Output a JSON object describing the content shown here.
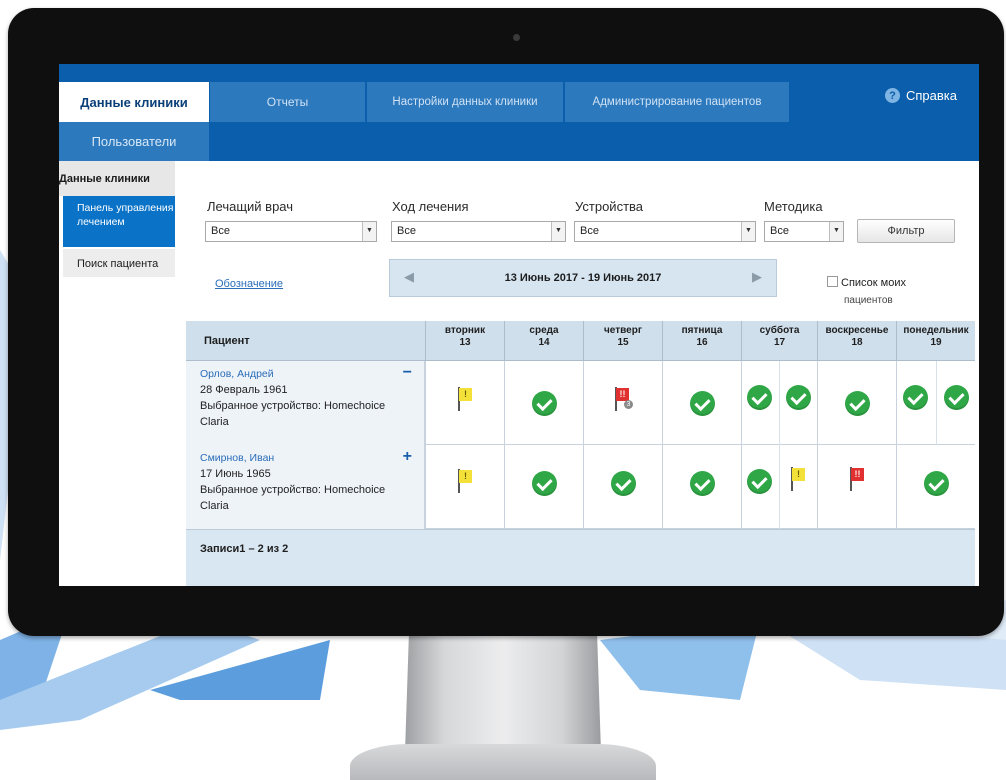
{
  "tabs": {
    "clinic_data": "Данные клиники",
    "reports": "Отчеты",
    "clinic_settings": "Настройки данных клиники",
    "patient_admin": "Администрирование пациентов",
    "users": "Пользователи"
  },
  "help": {
    "label": "Справка",
    "icon": "question-circle-icon"
  },
  "sidebar": {
    "header": "Данные клиники",
    "items": [
      {
        "label": "Панель управления лечением",
        "selected": true
      },
      {
        "label": "Поиск пациента",
        "selected": false
      }
    ]
  },
  "filters": {
    "doctor": {
      "label": "Лечащий врач",
      "value": "Все"
    },
    "treatment": {
      "label": "Ход лечения",
      "value": "Все"
    },
    "devices": {
      "label": "Устройства",
      "value": "Все"
    },
    "method": {
      "label": "Методика",
      "value": "Все"
    },
    "filter_button": "Фильтр"
  },
  "legend_link": "Обозначение",
  "date_range": "13 Июнь 2017 - 19 Июнь 2017",
  "my_patients": {
    "line1": "Список моих",
    "line2": "пациентов",
    "checked": false
  },
  "grid": {
    "patient_header": "Пациент",
    "days": [
      {
        "name": "вторник",
        "num": "13"
      },
      {
        "name": "среда",
        "num": "14"
      },
      {
        "name": "четверг",
        "num": "15"
      },
      {
        "name": "пятница",
        "num": "16"
      },
      {
        "name": "суббота",
        "num": "17"
      },
      {
        "name": "воскресенье",
        "num": "18"
      },
      {
        "name": "понедельник",
        "num": "19"
      }
    ],
    "patients": [
      {
        "name": "Орлов, Андрей",
        "dob": "28 Февраль 1961",
        "device_line1": "Выбранное устройство: Homechoice",
        "device_line2": "Claria",
        "toggle": "−",
        "days": [
          [
            "flag-yellow"
          ],
          [
            "ok"
          ],
          [
            "flag-red-3"
          ],
          [
            "ok"
          ],
          [
            "ok",
            "ok"
          ],
          [
            "ok"
          ],
          [
            "ok",
            "ok"
          ]
        ]
      },
      {
        "name": "Смирнов, Иван",
        "dob": "17 Июнь 1965",
        "device_line1": "Выбранное устройство: Homechoice",
        "device_line2": "Claria",
        "toggle": "+",
        "days": [
          [
            "flag-yellow"
          ],
          [
            "ok"
          ],
          [
            "ok"
          ],
          [
            "ok"
          ],
          [
            "ok",
            "flag-yellow"
          ],
          [
            "flag-red"
          ],
          [
            "ok"
          ]
        ]
      }
    ],
    "flag_badge": "3",
    "records": "Записи1 – 2 из 2"
  },
  "colors": {
    "header_blue": "#0a5eab",
    "ok_green": "#2fa746",
    "flag_yellow": "#f3e13a",
    "flag_red": "#e0302f"
  }
}
